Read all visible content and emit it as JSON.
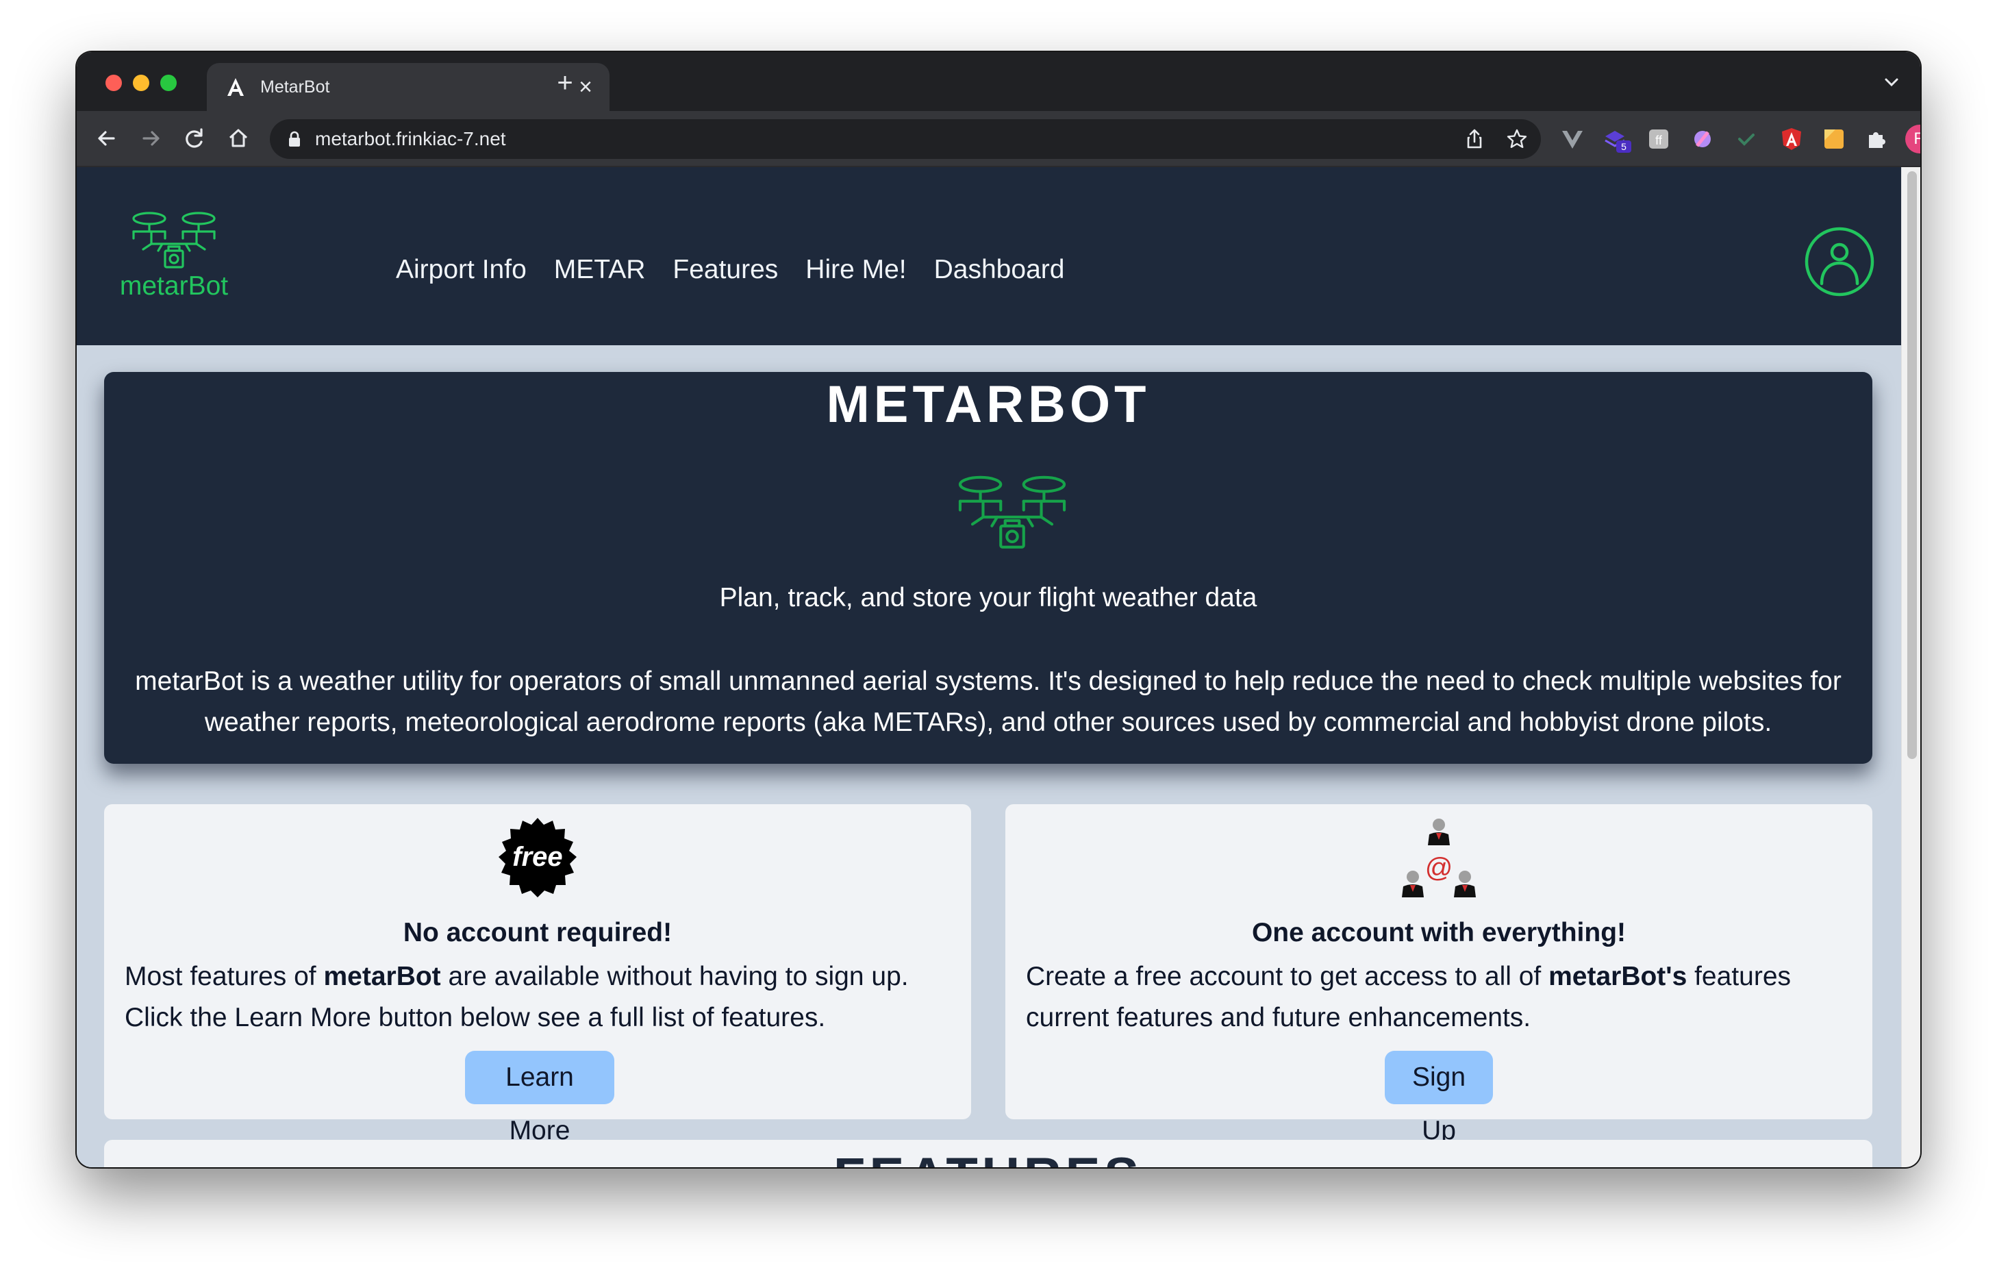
{
  "browser": {
    "tab_title": "MetarBot",
    "close_glyph": "×",
    "new_tab_glyph": "+",
    "url": "metarbot.frinkiac-7.net",
    "profile_initial": "R",
    "extension_badge": "5",
    "extension_letter": "ff"
  },
  "header": {
    "brand": "metarBot",
    "nav": [
      "Airport Info",
      "METAR",
      "Features",
      "Hire Me!",
      "Dashboard"
    ]
  },
  "hero": {
    "title": "METARBOT",
    "tagline": "Plan, track, and store your flight weather data",
    "description": "metarBot is a weather utility for operators of small unmanned aerial systems. It's designed to help reduce the need to check multiple websites for weather reports, meteorological aerodrome reports (aka METARs), and other sources used by commercial and hobbyist drone pilots."
  },
  "cards": {
    "left": {
      "badge_text": "free",
      "heading": "No account required!",
      "line1_prefix": "Most features of ",
      "line1_bold": "metarBot",
      "line1_suffix": " are available without having to sign up.",
      "line2": "Click the Learn More button below see a full list of features.",
      "button": "Learn More"
    },
    "right": {
      "at_glyph": "@",
      "heading": "One account with everything!",
      "line1_prefix": "Create a free account to get access to all of ",
      "line1_bold": "metarBot's",
      "line1_suffix": " features",
      "line2": "current features and future enhancements.",
      "button": "Sign Up"
    }
  },
  "features_section": {
    "title": "FEATURES"
  },
  "colors": {
    "header_bg": "#1e293b",
    "page_bg": "#cbd5e1",
    "brand_green": "#22c55e",
    "button_blue": "#93c5fd",
    "card_bg": "#f1f3f6"
  },
  "icons": {
    "logo": "drone-icon",
    "account": "user-circle-icon",
    "free": "free-badge-icon",
    "account_network": "people-network-icon"
  }
}
